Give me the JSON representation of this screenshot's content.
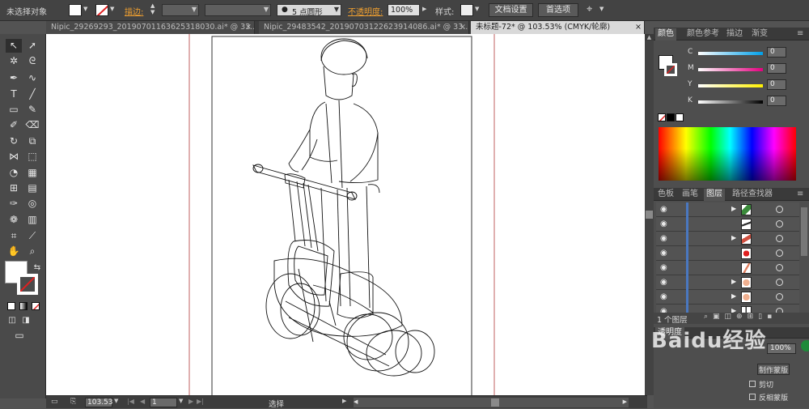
{
  "control_bar": {
    "selection": "未选择对象",
    "stroke_label": "描边:",
    "brush_size": "5 点圆形",
    "opacity_label": "不透明度:",
    "opacity_value": "100%",
    "style_label": "样式:",
    "doc_setup": "文档设置",
    "preferences": "首选项"
  },
  "tabs": [
    {
      "label": "Nipic_29269293_20190701163625318030.ai* @ 33...",
      "close": "×"
    },
    {
      "label": "Nipic_29483542_20190703122623914086.ai* @ 33...",
      "close": "×"
    },
    {
      "label": "未标题-72* @ 103.53% (CMYK/轮廓)",
      "close": "×"
    }
  ],
  "color_panel": {
    "tabs": [
      "颜色",
      "颜色参考",
      "描边",
      "渐变"
    ],
    "channels": [
      {
        "label": "C",
        "value": "0",
        "color": "#00a0e9"
      },
      {
        "label": "M",
        "value": "0",
        "color": "#e4007f"
      },
      {
        "label": "Y",
        "value": "0",
        "color": "#fff100"
      },
      {
        "label": "K",
        "value": "0",
        "color": "#000000"
      }
    ]
  },
  "layers_panel": {
    "tabs": [
      "色板",
      "画笔",
      "图层",
      "路径查找器"
    ],
    "rows": 8,
    "count_label": "1 个图层"
  },
  "transparency_panel": {
    "title": "透明度",
    "opacity": "100%",
    "make_mask": "制作蒙版",
    "clip": "剪切",
    "invert_mask": "反相蒙版"
  },
  "status_bar": {
    "zoom": "103.53",
    "page": "1",
    "tool": "选择"
  },
  "watermark": "Baidu经验"
}
